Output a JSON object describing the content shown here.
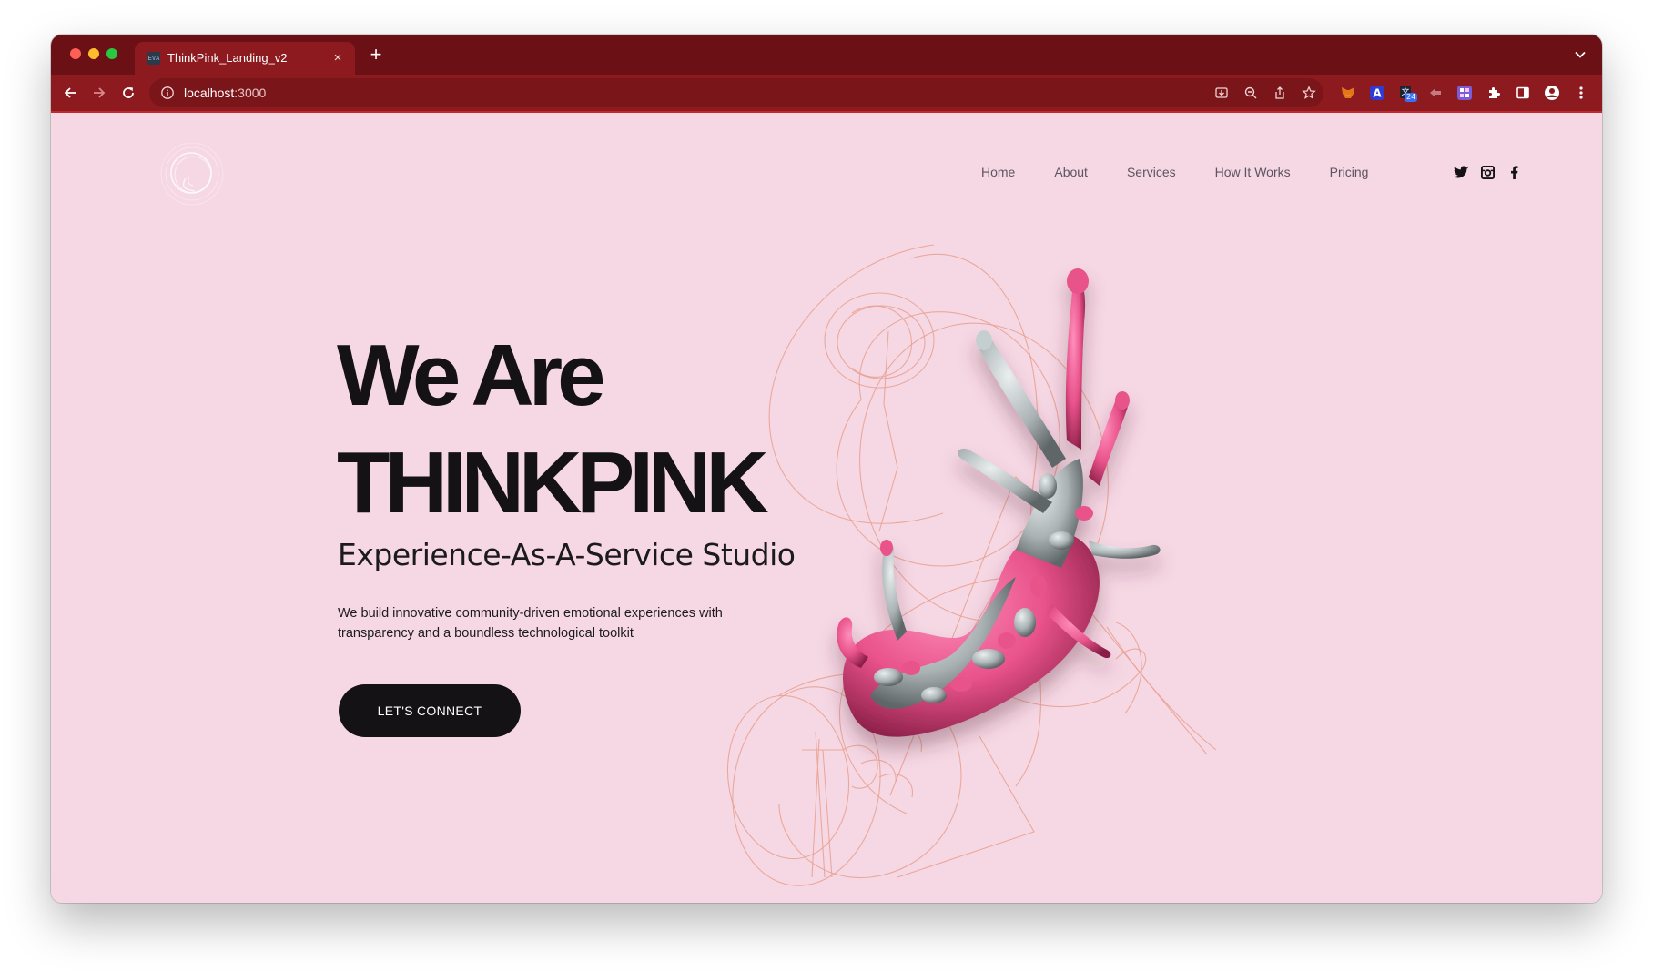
{
  "browser": {
    "tab": {
      "favicon_text": "EVA",
      "title": "ThinkPink_Landing_v2",
      "close": "×"
    },
    "new_tab": "+",
    "tab_menu": "⌄",
    "address": {
      "host": "localhost",
      "port": ":3000"
    },
    "extension_badge": "24"
  },
  "nav": {
    "links": [
      "Home",
      "About",
      "Services",
      "How It Works",
      "Pricing"
    ]
  },
  "hero": {
    "title_line1": "We Are",
    "title_line2": "THINKPINK",
    "subtitle": "Experience-As-A-Service Studio",
    "description_line1": "We build innovative community-driven emotional experiences with",
    "description_line2": "transparency and a boundless technological toolkit",
    "cta": "LET'S CONNECT"
  },
  "colors": {
    "tab_strip": "#6b1015",
    "toolbar": "#8c1a1f",
    "page_background": "#f6d8e4",
    "text_dark": "#141214",
    "sketch_lines": "#e8a08f",
    "blob_pink": "#e8528a",
    "blob_gray": "#aab2b4"
  },
  "icons": [
    "back-icon",
    "forward-icon",
    "reload-icon",
    "info-icon",
    "install-icon",
    "zoom-icon",
    "share-icon",
    "star-icon",
    "metamask-icon",
    "extension-a-icon",
    "extension-translate-icon",
    "extension-arrow-icon",
    "extension-grid-icon",
    "puzzle-icon",
    "sidebar-icon",
    "profile-icon",
    "menu-icon",
    "twitter-icon",
    "instagram-icon",
    "facebook-icon"
  ]
}
